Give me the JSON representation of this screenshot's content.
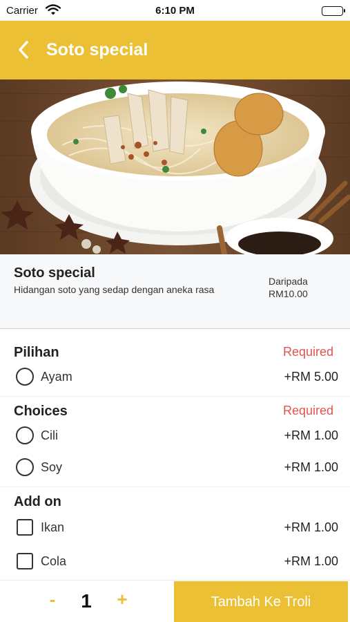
{
  "status_bar": {
    "carrier": "Carrier",
    "time": "6:10 PM"
  },
  "nav": {
    "title": "Soto special",
    "back_icon": "chevron-left-icon"
  },
  "hero": {
    "image": "bowl-of-soto-photo"
  },
  "item": {
    "name": "Soto special",
    "description": "Hidangan soto yang sedap dengan aneka rasa",
    "from_label": "Daripada",
    "from_price": "RM10.00"
  },
  "sections": {
    "pilihan": {
      "title": "Pilihan",
      "required": "Required",
      "options": [
        {
          "label": "Ayam",
          "price": "+RM 5.00"
        }
      ]
    },
    "choices": {
      "title": "Choices",
      "required": "Required",
      "options": [
        {
          "label": "Cili",
          "price": "+RM 1.00"
        },
        {
          "label": "Soy",
          "price": "+RM 1.00"
        }
      ]
    },
    "addon": {
      "title": "Add on",
      "options": [
        {
          "label": "Ikan",
          "price": "+RM 1.00"
        },
        {
          "label": "Cola",
          "price": "+RM 1.00"
        }
      ]
    }
  },
  "bottom": {
    "minus": "-",
    "quantity": "1",
    "plus": "+",
    "add_button": "Tambah Ke Troli"
  },
  "colors": {
    "accent": "#ebc034",
    "required": "#e0554f"
  }
}
